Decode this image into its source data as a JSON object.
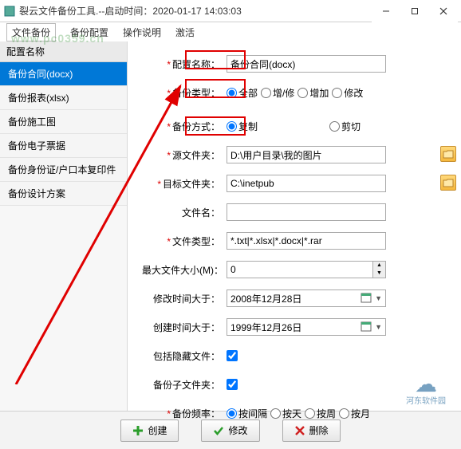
{
  "titlebar": {
    "title": "裂云文件备份工具.--启动时间：2020-01-17 14:03:03"
  },
  "menubar": {
    "tab": "文件备份",
    "items": [
      "备份配置",
      "操作说明",
      "激活"
    ]
  },
  "watermark": "www.pc0359.cn",
  "sidebar": {
    "header": "配置名称",
    "items": [
      "备份合同(docx)",
      "备份报表(xlsx)",
      "备份施工图",
      "备份电子票据",
      "备份身份证/户口本复印件",
      "备份设计方案"
    ],
    "selected": 0
  },
  "form": {
    "config_name": {
      "label": "配置名称：",
      "value": "备份合同(docx)"
    },
    "backup_type": {
      "label": "备份类型：",
      "options": [
        "全部",
        "增/修",
        "增加",
        "修改"
      ],
      "selected": "全部"
    },
    "backup_mode": {
      "label": "备份方式：",
      "options": [
        "复制",
        "剪切"
      ],
      "selected": "复制"
    },
    "source_dir": {
      "label": "源文件夹：",
      "value": "D:\\用户目录\\我的图片"
    },
    "target_dir": {
      "label": "目标文件夹：",
      "value": "C:\\inetpub"
    },
    "file_name": {
      "label": "文件名：",
      "value": ""
    },
    "file_type": {
      "label": "文件类型：",
      "value": "*.txt|*.xlsx|*.docx|*.rar"
    },
    "max_size": {
      "label": "最大文件大小(M)：",
      "value": "0"
    },
    "mod_after": {
      "label": "修改时间大于：",
      "value": "2008年12月28日"
    },
    "create_after": {
      "label": "创建时间大于：",
      "value": "1999年12月26日"
    },
    "include_hidden": {
      "label": "包括隐藏文件：",
      "checked": true
    },
    "backup_subdir": {
      "label": "备份子文件夹：",
      "checked": true
    },
    "backup_freq": {
      "label": "备份频率：",
      "options": [
        "按间隔",
        "按天",
        "按周",
        "按月"
      ],
      "selected": "按间隔"
    }
  },
  "buttons": {
    "create": "创建",
    "modify": "修改",
    "delete": "删除"
  },
  "logo_text": "河东软件园"
}
